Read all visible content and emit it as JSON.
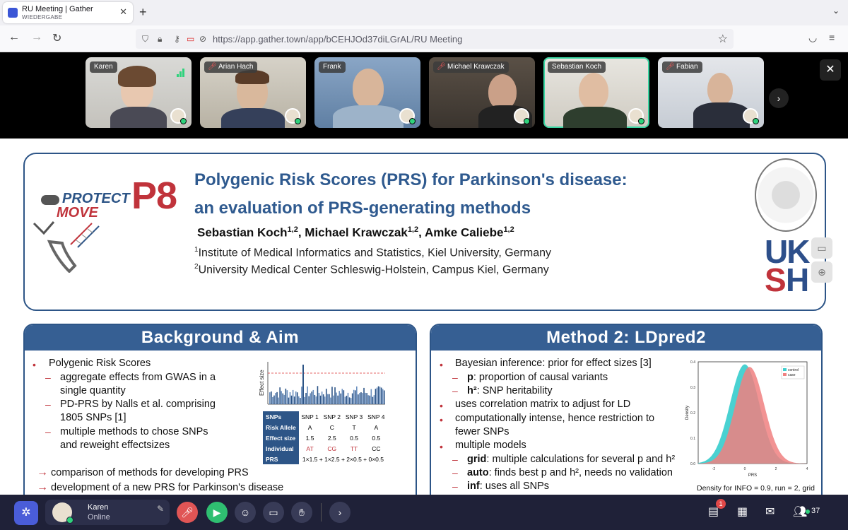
{
  "browser": {
    "tab_title": "RU Meeting | Gather",
    "tab_subtitle": "WIEDERGABE",
    "new_tab": "+",
    "tab_close": "✕",
    "url": "https://app.gather.town/app/bCEHJOd37diLGrAL/RU Meeting"
  },
  "participants": [
    {
      "name": "Karen",
      "muted": false
    },
    {
      "name": "Arian Hach",
      "muted": true
    },
    {
      "name": "Frank",
      "muted": false
    },
    {
      "name": "Michael Krawczak",
      "muted": true
    },
    {
      "name": "Sebastian Koch",
      "muted": false
    },
    {
      "name": "Fabian",
      "muted": true
    }
  ],
  "poster": {
    "logo_protect": "PROTECT",
    "logo_move": "MOVE",
    "project_code": "P8",
    "title_line1": "Polygenic Risk Scores (PRS) for Parkinson's disease:",
    "title_line2": "an evaluation of PRS-generating methods",
    "authors": [
      {
        "name": "Sebastian Koch",
        "sup": "1,2"
      },
      {
        "name": "Michael Krawczak",
        "sup": "1,2"
      },
      {
        "name": "Amke Caliebe",
        "sup": "1,2"
      }
    ],
    "affiliation1_sup": "1",
    "affiliation1": "Institute of Medical Informatics and Statistics, Kiel University, Germany",
    "affiliation2_sup": "2",
    "affiliation2": "University Medical Center Schleswig-Holstein, Campus Kiel, Germany",
    "uksh": {
      "uk": "UK",
      "s": "S",
      "h": "H"
    },
    "background": {
      "heading": "Background & Aim",
      "bullet1": "Polygenic Risk Scores",
      "sub1a": "aggregate effects from GWAS in a",
      "sub1a2": "single quantity",
      "sub1b": "PD-PRS by Nalls et al. comprising",
      "sub1b2": "1805 SNPs [1]",
      "sub1c": "multiple methods to chose SNPs",
      "sub1c2": "and reweight effectsizes",
      "arrow1": "comparison of methods for developing PRS",
      "arrow2": "development of a new PRS for Parkinson's disease",
      "figure_ylabel": "Effect size",
      "table": {
        "headers": [
          "SNPs",
          "SNP 1",
          "SNP 2",
          "SNP 3",
          "SNP 4"
        ],
        "risk_allele": [
          "Risk Allele",
          "A",
          "C",
          "T",
          "A"
        ],
        "effect_size": [
          "Effect size",
          "1.5",
          "2.5",
          "0.5",
          "0.5"
        ],
        "individual": [
          "Individual",
          "AT",
          "CG",
          "TT",
          "CC"
        ],
        "prs_label": "PRS",
        "prs_formula": "1×1.5 + 1×2.5 + 2×0.5 + 0×0.5"
      }
    },
    "method": {
      "heading": "Method 2: LDpred2",
      "b1": "Bayesian inference: prior for effect sizes [3]",
      "s1a_bold": "p",
      "s1a": ": proportion of causal variants",
      "s1b_bold": "h²",
      "s1b": ": SNP heritability",
      "b2": "uses correlation matrix to adjust for LD",
      "b3": "computationally intense, hence restriction to",
      "b3b": "fewer SNPs",
      "b4": "multiple models",
      "s4a_bold": "grid",
      "s4a": ": multiple calculations for several p and h²",
      "s4b_bold": "auto",
      "s4b": ": finds best p and h², needs no validation",
      "s4c_bold": "inf",
      "s4c": ": uses all SNPs",
      "caption": "Density for INFO = 0.9, run = 2, grid"
    }
  },
  "chart_data": {
    "type": "area",
    "title": "",
    "xlabel": "PRS",
    "ylabel": "Density",
    "xlim": [
      -3,
      4
    ],
    "ylim": [
      0,
      0.4
    ],
    "x_ticks": [
      "-2",
      "0",
      "2",
      "4"
    ],
    "y_ticks": [
      "0.0",
      "0.1",
      "0.2",
      "0.3",
      "0.4"
    ],
    "legend_position": "top-right",
    "series": [
      {
        "name": "control",
        "color": "#3fcfcf",
        "mean": 0.0,
        "peak": 0.39
      },
      {
        "name": "case",
        "color": "#f08080",
        "mean": 0.3,
        "peak": 0.38
      }
    ]
  },
  "bottom": {
    "user_name": "Karen",
    "user_status": "Online",
    "notification_count": "1",
    "participant_count": "37"
  },
  "colors": {
    "accent_blue": "#2d5587",
    "accent_red": "#c0333b",
    "gather_bar": "#1f2138"
  }
}
